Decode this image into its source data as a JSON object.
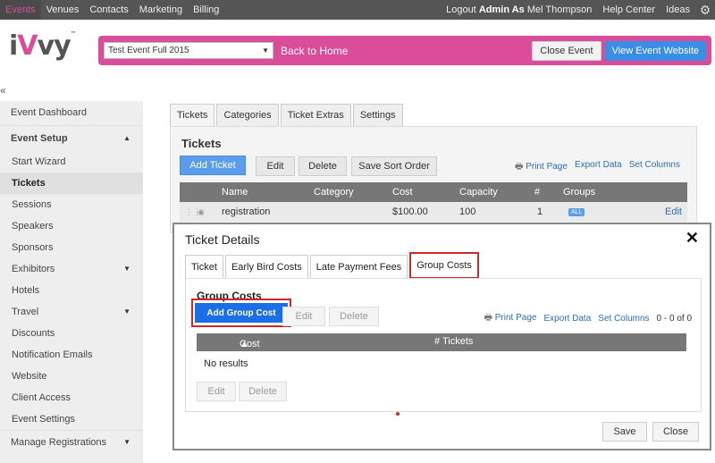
{
  "topnav": {
    "items": [
      "Events",
      "Venues",
      "Contacts",
      "Marketing",
      "Billing"
    ],
    "logout_prefix": "Logout",
    "logout_user": "Admin As",
    "logout_name": "Mel Thompson",
    "help": "Help Center",
    "ideas": "Ideas"
  },
  "logo": {
    "prefix": "i",
    "v": "V",
    "suffix": "vy",
    "tm": "™"
  },
  "eventbar": {
    "selected_event": "Test Event Full 2015",
    "back_home": "Back to Home",
    "close_event": "Close Event",
    "view_site": "View Event Website"
  },
  "sidebar": {
    "collapse": "«",
    "items": [
      "Event Dashboard",
      "Event Setup",
      "Start Wizard",
      "Tickets",
      "Sessions",
      "Speakers",
      "Sponsors",
      "Exhibitors",
      "Hotels",
      "Travel",
      "Discounts",
      "Notification Emails",
      "Website",
      "Client Access",
      "Event Settings",
      "Manage Registrations"
    ]
  },
  "main": {
    "tabs": [
      "Tickets",
      "Categories",
      "Ticket Extras",
      "Settings"
    ],
    "title": "Tickets",
    "add_ticket": "Add Ticket",
    "edit": "Edit",
    "delete": "Delete",
    "save_sort": "Save Sort Order",
    "print": "Print Page",
    "export": "Export Data",
    "set_columns": "Set Columns",
    "columns": [
      "Name",
      "Category",
      "Cost",
      "Capacity",
      "#",
      "Groups"
    ],
    "row": {
      "name": "registration",
      "cost": "$100.00",
      "capacity": "100",
      "num": "1",
      "group": "ALL",
      "edit": "Edit"
    }
  },
  "modal": {
    "title": "Ticket Details",
    "close": "✕",
    "tabs": [
      "Ticket",
      "Early Bird Costs",
      "Late Payment Fees",
      "Group Costs"
    ],
    "section_title": "Group Costs",
    "add_group_cost": "Add Group Cost",
    "edit": "Edit",
    "delete": "Delete",
    "print": "Print Page",
    "export": "Export Data",
    "set_columns": "Set Columns",
    "count": "0 - 0 of 0",
    "col_cost": "Cost",
    "col_tickets": "# Tickets",
    "no_results": "No results",
    "save": "Save",
    "close_btn": "Close"
  },
  "colors": {
    "brand_pink": "#d94d9a",
    "primary_blue": "#3a8ee6",
    "highlight_red": "#cc2a2a"
  }
}
